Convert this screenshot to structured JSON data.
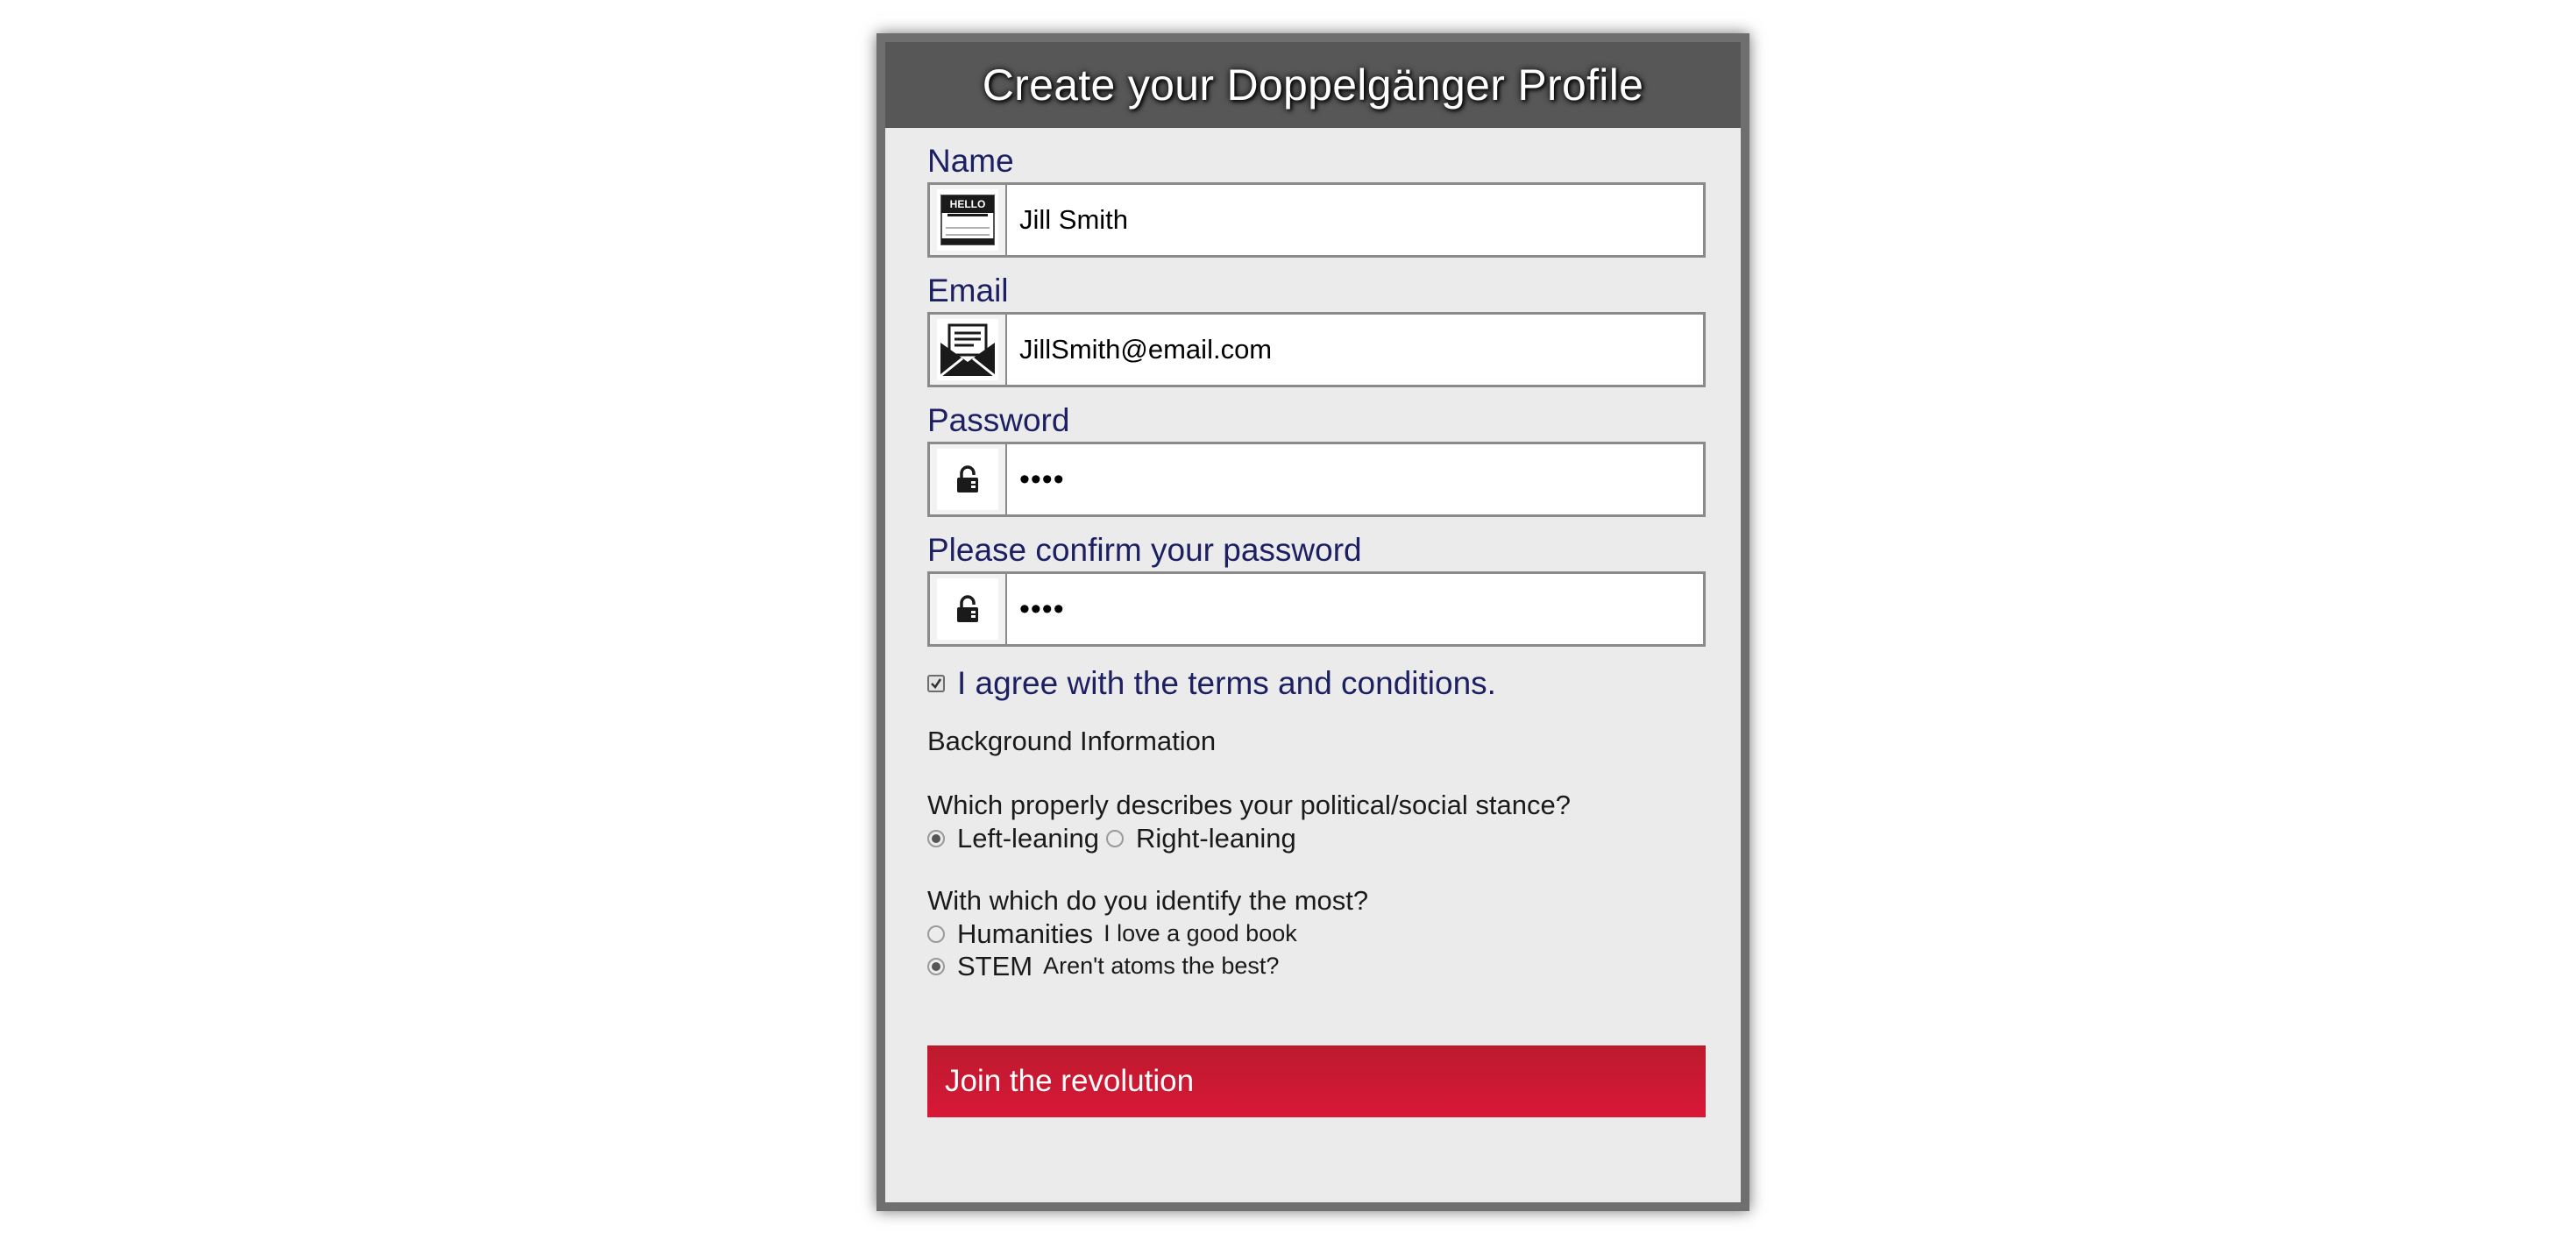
{
  "header": {
    "title": "Create your Doppelgänger Profile"
  },
  "form": {
    "name": {
      "label": "Name",
      "value": "Jill Smith",
      "icon": "hello-name-tag-icon"
    },
    "email": {
      "label": "Email",
      "value": "JillSmith@email.com",
      "icon": "open-envelope-icon"
    },
    "password": {
      "label": "Password",
      "value": "abcd",
      "icon": "lock-icon"
    },
    "confirm_password": {
      "label": "Please confirm your password",
      "value": "abcd",
      "icon": "lock-icon"
    },
    "terms": {
      "label": "I agree with the terms and conditions.",
      "checked": true
    },
    "background_title": "Background Information",
    "stance": {
      "question": "Which properly describes your political/social stance?",
      "options": [
        {
          "label": "Left-leaning",
          "checked": true
        },
        {
          "label": "Right-leaning",
          "checked": false
        }
      ]
    },
    "identity": {
      "question": "With which do you identify the most?",
      "options": [
        {
          "label": "Humanities",
          "sub": "I love a good book",
          "checked": false
        },
        {
          "label": "STEM",
          "sub": "Aren't atoms the best?",
          "checked": true
        }
      ]
    },
    "submit_label": "Join the revolution"
  },
  "colors": {
    "header_bg": "#575757",
    "card_bg": "#ebebeb",
    "label": "#1c1f62",
    "submit": "#c8192f"
  }
}
